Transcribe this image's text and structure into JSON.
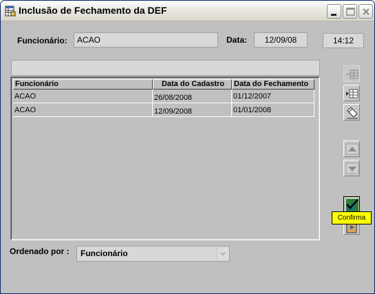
{
  "window": {
    "title": "Inclusão de Fechamento da DEF",
    "app_icon": "table-icon",
    "controls": [
      "minimize-icon",
      "maximize-icon",
      "close-icon"
    ]
  },
  "form": {
    "funcionario_label": "Funcionário:",
    "funcionario_value": "ACAO",
    "data_label": "Data:",
    "data_value": "12/09/08",
    "hora_value": "14:12"
  },
  "grid": {
    "columns": [
      "Funcionário",
      "Data do Cadastro",
      "Data do Fechamento"
    ],
    "rows": [
      [
        "ACAO",
        "26/08/2008",
        "01/12/2007"
      ],
      [
        "ACAO",
        "12/09/2008",
        "01/01/2008"
      ]
    ]
  },
  "toolbar": {
    "buttons": [
      "add-row-icon",
      "insert-row-icon",
      "edit-icon",
      "move-up-icon",
      "move-down-icon",
      "confirm-icon",
      "exit-icon"
    ],
    "tooltip": "Confirma"
  },
  "order": {
    "label": "Ordenado por :",
    "value": "Funcionário"
  },
  "colors": {
    "window_bg": "#c0c0c0",
    "tooltip_bg": "#ffff00"
  }
}
